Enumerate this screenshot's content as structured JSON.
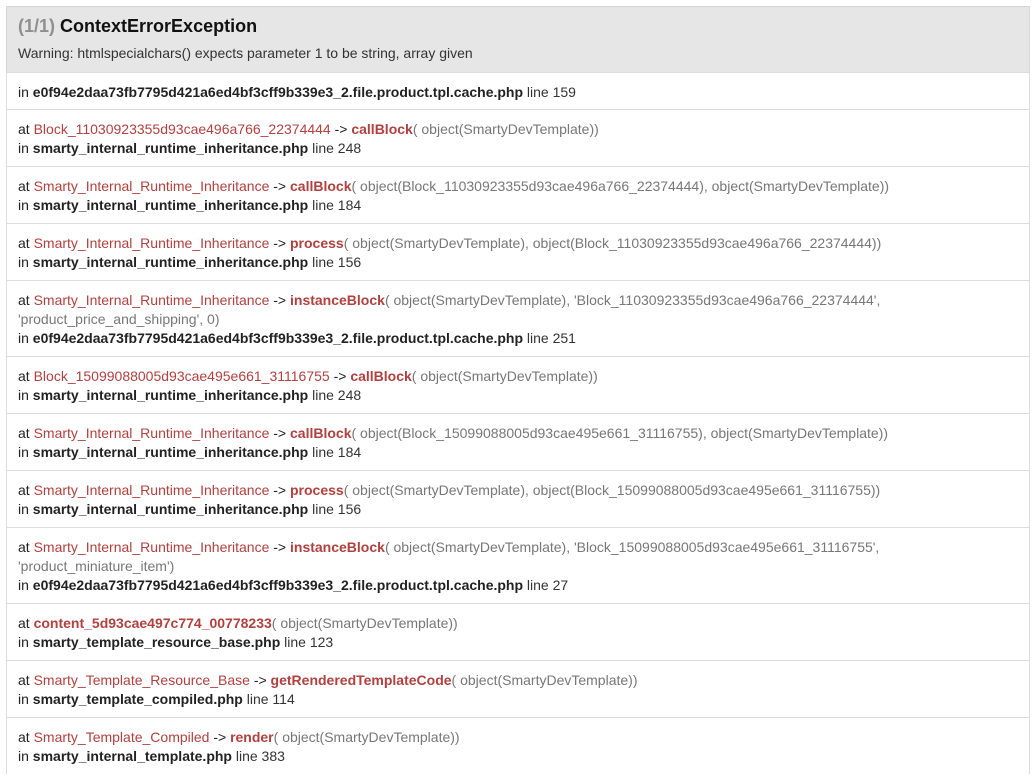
{
  "header": {
    "counter": "(1/1)",
    "exception": "ContextErrorException",
    "message": "Warning: htmlspecialchars() expects parameter 1 to be string, array given"
  },
  "first": {
    "in": "in",
    "file": "e0f94e2daa73fb7795d421a6ed4bf3cff9b339e3_2.file.product.tpl.cache.php",
    "line": "line 159"
  },
  "frames": [
    {
      "at": "at",
      "cls": "Block_11030923355d93cae496a766_22374444",
      "arrow": "->",
      "fn": "callBlock",
      "args_l1": "( object(SmartyDevTemplate))",
      "args_l2": "",
      "in": "in",
      "file": "smarty_internal_runtime_inheritance.php",
      "line": "line 248"
    },
    {
      "at": "at",
      "cls": "Smarty_Internal_Runtime_Inheritance",
      "arrow": "->",
      "fn": "callBlock",
      "args_l1": "( object(Block_11030923355d93cae496a766_22374444), object(SmartyDevTemplate))",
      "args_l2": "",
      "in": "in",
      "file": "smarty_internal_runtime_inheritance.php",
      "line": "line 184"
    },
    {
      "at": "at",
      "cls": "Smarty_Internal_Runtime_Inheritance",
      "arrow": "->",
      "fn": "process",
      "args_l1": "( object(SmartyDevTemplate), object(Block_11030923355d93cae496a766_22374444))",
      "args_l2": "",
      "in": "in",
      "file": "smarty_internal_runtime_inheritance.php",
      "line": "line 156"
    },
    {
      "at": "at",
      "cls": "Smarty_Internal_Runtime_Inheritance",
      "arrow": "->",
      "fn": "instanceBlock",
      "args_l1": "( object(SmartyDevTemplate), 'Block_11030923355d93cae496a766_22374444',",
      "args_l2": "'product_price_and_shipping', 0)",
      "in": "in",
      "file": "e0f94e2daa73fb7795d421a6ed4bf3cff9b339e3_2.file.product.tpl.cache.php",
      "line": "line 251"
    },
    {
      "at": "at",
      "cls": "Block_15099088005d93cae495e661_31116755",
      "arrow": "->",
      "fn": "callBlock",
      "args_l1": "( object(SmartyDevTemplate))",
      "args_l2": "",
      "in": "in",
      "file": "smarty_internal_runtime_inheritance.php",
      "line": "line 248"
    },
    {
      "at": "at",
      "cls": "Smarty_Internal_Runtime_Inheritance",
      "arrow": "->",
      "fn": "callBlock",
      "args_l1": "( object(Block_15099088005d93cae495e661_31116755), object(SmartyDevTemplate))",
      "args_l2": "",
      "in": "in",
      "file": "smarty_internal_runtime_inheritance.php",
      "line": "line 184"
    },
    {
      "at": "at",
      "cls": "Smarty_Internal_Runtime_Inheritance",
      "arrow": "->",
      "fn": "process",
      "args_l1": "( object(SmartyDevTemplate), object(Block_15099088005d93cae495e661_31116755))",
      "args_l2": "",
      "in": "in",
      "file": "smarty_internal_runtime_inheritance.php",
      "line": "line 156"
    },
    {
      "at": "at",
      "cls": "Smarty_Internal_Runtime_Inheritance",
      "arrow": "->",
      "fn": "instanceBlock",
      "args_l1": "( object(SmartyDevTemplate), 'Block_15099088005d93cae495e661_31116755',",
      "args_l2": "'product_miniature_item')",
      "in": "in",
      "file": "e0f94e2daa73fb7795d421a6ed4bf3cff9b339e3_2.file.product.tpl.cache.php",
      "line": "line 27"
    },
    {
      "at": "at",
      "cls": "",
      "arrow": "",
      "fn": "content_5d93cae497c774_00778233",
      "args_l1": "( object(SmartyDevTemplate))",
      "args_l2": "",
      "in": "in",
      "file": "smarty_template_resource_base.php",
      "line": "line 123"
    },
    {
      "at": "at",
      "cls": "Smarty_Template_Resource_Base",
      "arrow": "->",
      "fn": "getRenderedTemplateCode",
      "args_l1": "( object(SmartyDevTemplate))",
      "args_l2": "",
      "in": "in",
      "file": "smarty_template_compiled.php",
      "line": "line 114"
    },
    {
      "at": "at",
      "cls": "Smarty_Template_Compiled",
      "arrow": "->",
      "fn": "render",
      "args_l1": "( object(SmartyDevTemplate))",
      "args_l2": "",
      "in": "in",
      "file": "smarty_internal_template.php",
      "line": "line 383"
    }
  ]
}
